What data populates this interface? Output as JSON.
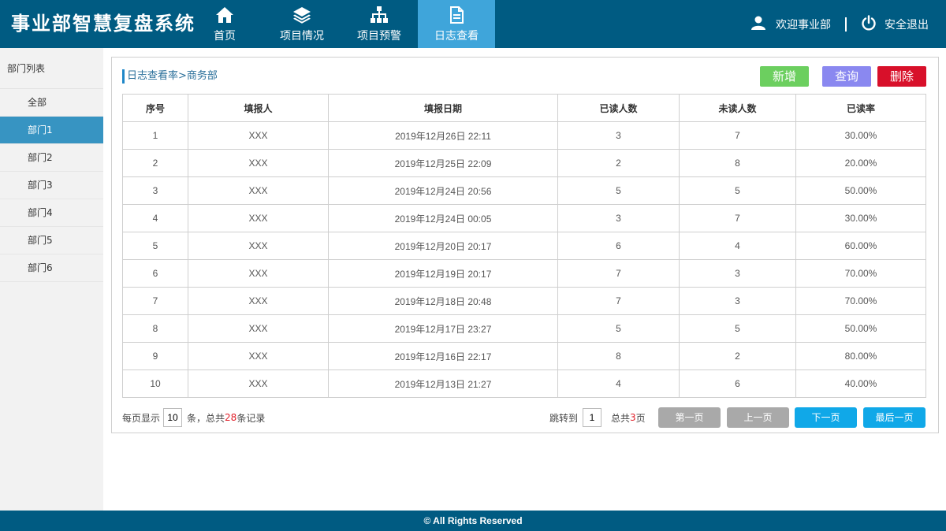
{
  "header": {
    "title": "事业部智慧复盘系统",
    "nav": [
      {
        "label": "首页",
        "icon": "home-icon"
      },
      {
        "label": "项目情况",
        "icon": "layers-icon"
      },
      {
        "label": "项目预警",
        "icon": "sitemap-icon"
      },
      {
        "label": "日志查看",
        "icon": "document-icon"
      }
    ],
    "active_nav": 3,
    "welcome": "欢迎事业部",
    "logout": "安全退出"
  },
  "sidebar": {
    "title": "部门列表",
    "items": [
      "全部",
      "部门1",
      "部门2",
      "部门3",
      "部门4",
      "部门5",
      "部门6"
    ],
    "active": 1
  },
  "main": {
    "breadcrumb": "日志查看率>商务部",
    "buttons": {
      "add": "新增",
      "query": "查询",
      "delete": "删除"
    },
    "columns": [
      "序号",
      "填报人",
      "填报日期",
      "已读人数",
      "未读人数",
      "已读率"
    ],
    "rows": [
      [
        "1",
        "XXX",
        "2019年12月26日 22:11",
        "3",
        "7",
        "30.00%"
      ],
      [
        "2",
        "XXX",
        "2019年12月25日 22:09",
        "2",
        "8",
        "20.00%"
      ],
      [
        "3",
        "XXX",
        "2019年12月24日 20:56",
        "5",
        "5",
        "50.00%"
      ],
      [
        "4",
        "XXX",
        "2019年12月24日 00:05",
        "3",
        "7",
        "30.00%"
      ],
      [
        "5",
        "XXX",
        "2019年12月20日 20:17",
        "6",
        "4",
        "60.00%"
      ],
      [
        "6",
        "XXX",
        "2019年12月19日 20:17",
        "7",
        "3",
        "70.00%"
      ],
      [
        "7",
        "XXX",
        "2019年12月18日 20:48",
        "7",
        "3",
        "70.00%"
      ],
      [
        "8",
        "XXX",
        "2019年12月17日 23:27",
        "5",
        "5",
        "50.00%"
      ],
      [
        "9",
        "XXX",
        "2019年12月16日 22:17",
        "8",
        "2",
        "80.00%"
      ],
      [
        "10",
        "XXX",
        "2019年12月13日 21:27",
        "4",
        "6",
        "40.00%"
      ]
    ],
    "pager": {
      "per_page_label": "每页显示",
      "per_page_value": "10",
      "records_prefix": "条，总共",
      "records_total": "28",
      "records_suffix": "条记录",
      "jump_label": "跳转到",
      "jump_value": "1",
      "pages_prefix": "总共",
      "pages_total": "3",
      "pages_suffix": "页",
      "first": "第一页",
      "prev": "上一页",
      "next": "下一页",
      "last": "最后一页"
    }
  },
  "footer": {
    "text": "© All Rights Reserved"
  },
  "colors": {
    "header_bg": "#005b82",
    "nav_active": "#3fa5da",
    "sidebar_active": "#3794c2",
    "add": "#6ccf5f",
    "query": "#8a88f0",
    "delete": "#d8102a",
    "pager_gray": "#a9a9a9",
    "pager_blue": "#10a8e8"
  }
}
